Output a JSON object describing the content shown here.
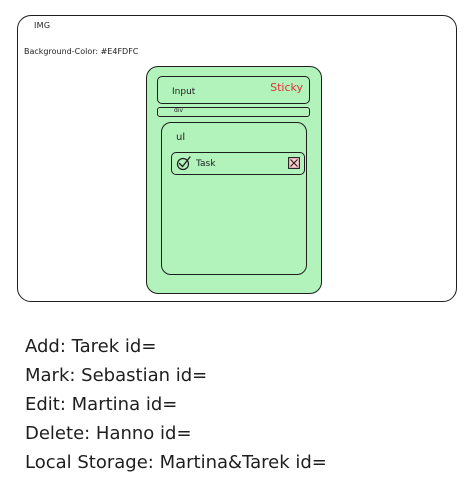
{
  "frame": {
    "img_label": "IMG",
    "background_label": "Background-Color: #E4FDFC"
  },
  "app": {
    "input_label": "Input",
    "title": "Sticky",
    "div_label": "div",
    "list_label": "ul",
    "task": {
      "label": "Task",
      "check_icon": "check-circle-icon",
      "delete_icon": "close-box-icon"
    }
  },
  "notes": [
    "Add: Tarek id=",
    "Mark: Sebastian id=",
    "Edit: Martina id=",
    "Delete: Hanno id=",
    "Local Storage: Martina&Tarek id="
  ],
  "colors": {
    "app_fill": "#b2f2bb",
    "title_color": "#e03131",
    "stroke": "#1e1e1e",
    "delete_fill": "#ffc9c9"
  }
}
